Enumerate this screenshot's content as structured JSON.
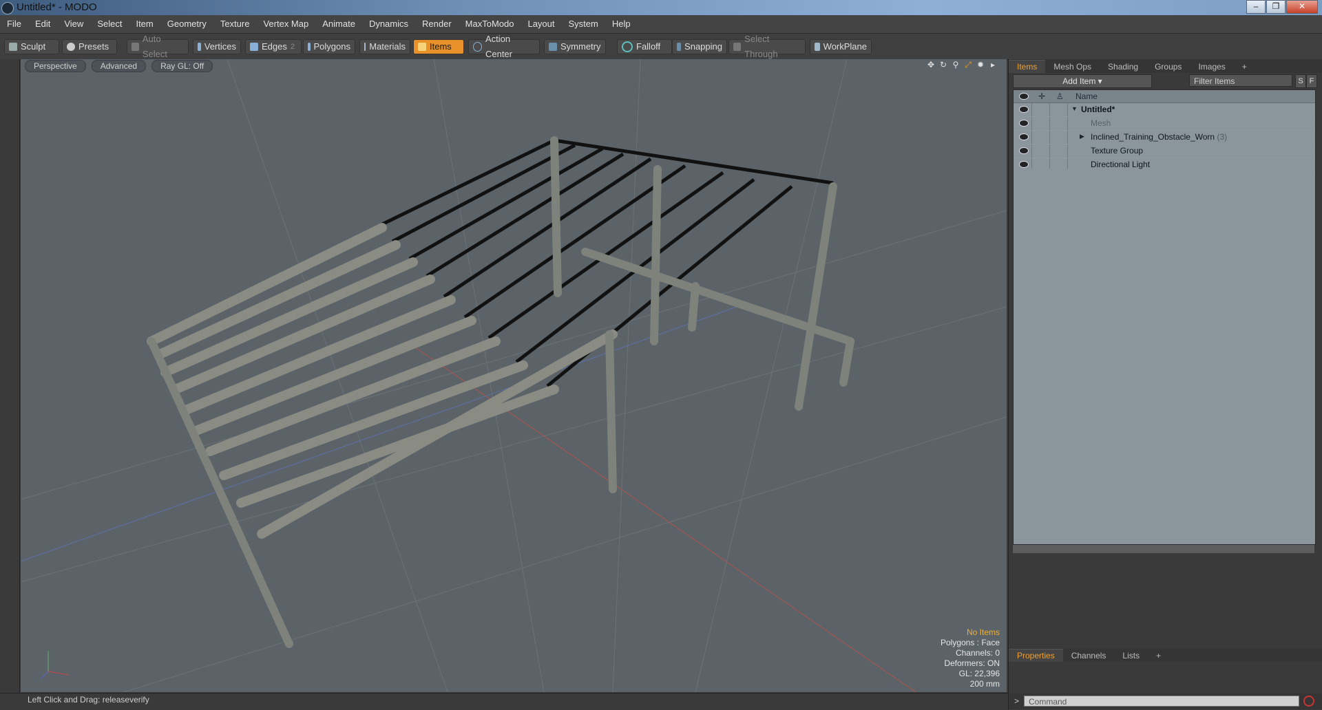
{
  "window": {
    "title": "Untitled* - MODO",
    "minimize": "‒",
    "maximize": "❐",
    "close": "✕"
  },
  "menu": [
    "File",
    "Edit",
    "View",
    "Select",
    "Item",
    "Geometry",
    "Texture",
    "Vertex Map",
    "Animate",
    "Dynamics",
    "Render",
    "MaxToModo",
    "Layout",
    "System",
    "Help"
  ],
  "toolbar": {
    "sculpt": "Sculpt",
    "presets": "Presets",
    "auto_select": "Auto Select",
    "vertices": "Vertices",
    "edges": "Edges",
    "edges_count": "2",
    "polygons": "Polygons",
    "materials": "Materials",
    "items": "Items",
    "action_center": "Action Center",
    "symmetry": "Symmetry",
    "falloff": "Falloff",
    "snapping": "Snapping",
    "select_through": "Select Through",
    "workplane": "WorkPlane"
  },
  "viewport": {
    "tabs": [
      "Perspective",
      "Advanced",
      "Ray GL: Off"
    ],
    "info": {
      "line1": "No Items",
      "line2": "Polygons : Face",
      "line3": "Channels: 0",
      "line4": "Deformers: ON",
      "line5": "GL: 22,396",
      "line6": "200 mm"
    }
  },
  "status": "Left Click and Drag:  releaseverify",
  "panel": {
    "tabs": [
      "Items",
      "Mesh Ops",
      "Shading",
      "Groups",
      "Images",
      "+"
    ],
    "add_item": "Add Item",
    "filter": "Filter Items",
    "s": "S",
    "f": "F",
    "name_col": "Name",
    "rows": [
      {
        "label": "Untitled*"
      },
      {
        "label": "Mesh"
      },
      {
        "label": "Inclined_Training_Obstacle_Worn",
        "count": "(3)"
      },
      {
        "label": "Texture Group"
      },
      {
        "label": "Directional Light"
      }
    ],
    "bottom_tabs": [
      "Properties",
      "Channels",
      "Lists",
      "+"
    ],
    "command_prompt": ">",
    "command_placeholder": "Command"
  }
}
